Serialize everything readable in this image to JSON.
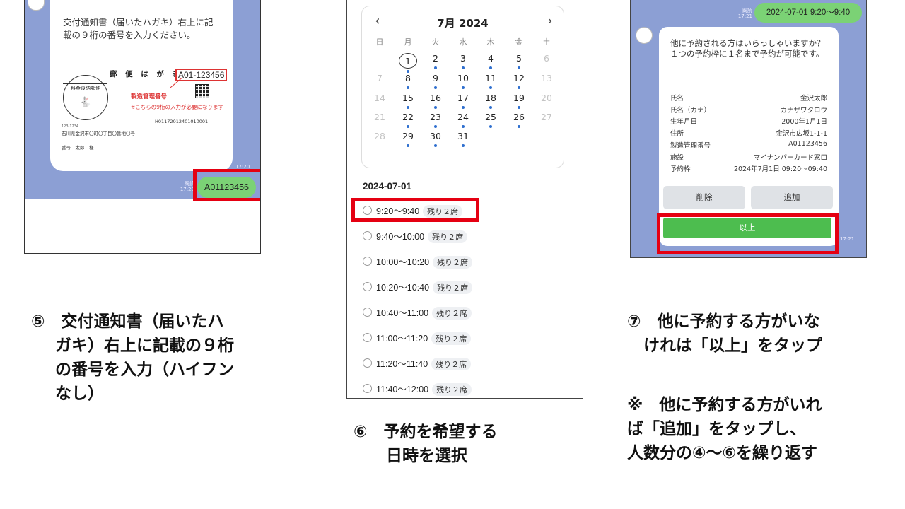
{
  "panel1": {
    "instruction": [
      "交付通知書（届いたハガキ）右上に記",
      "載の９桁の番号を入力ください。"
    ],
    "postcard": {
      "title": "郵 便 は が き",
      "number": "A01-123456",
      "stamp_label": "料金後納郵便",
      "label": "製造管理番号",
      "note": "※こちらの9桁の入力が必要になります",
      "id_line": "H01172012401010001",
      "zip": "123-1234",
      "address": "石川県金沢市〇町〇丁目〇番地〇号",
      "name": "番号　太郎　様"
    },
    "bubble_time": "17:20",
    "read_label": "既読",
    "reply_time": "17:20",
    "reply": "A01123456"
  },
  "caption5": [
    "⑤　交付通知書（届いたハ",
    "ガキ）右上に記載の９桁",
    "の番号を入力（ハイフン",
    "なし）"
  ],
  "panel2": {
    "month_label": "7月 2024",
    "prev_icon": "‹",
    "next_icon": "›",
    "weekdays": [
      "日",
      "月",
      "火",
      "水",
      "木",
      "金",
      "土"
    ],
    "weeks": [
      [
        "",
        "1",
        "2",
        "3",
        "4",
        "5",
        "6"
      ],
      [
        "7",
        "8",
        "9",
        "10",
        "11",
        "12",
        "13"
      ],
      [
        "14",
        "15",
        "16",
        "17",
        "18",
        "19",
        "20"
      ],
      [
        "21",
        "22",
        "23",
        "24",
        "25",
        "26",
        "27"
      ],
      [
        "28",
        "29",
        "30",
        "31",
        "",
        "",
        ""
      ]
    ],
    "selected_date": "2024-07-01",
    "slots": [
      {
        "time": "9:20〜9:40",
        "seats": "残り２席"
      },
      {
        "time": "9:40〜10:00",
        "seats": "残り２席"
      },
      {
        "time": "10:00〜10:20",
        "seats": "残り２席"
      },
      {
        "time": "10:20〜10:40",
        "seats": "残り２席"
      },
      {
        "time": "10:40〜11:00",
        "seats": "残り２席"
      },
      {
        "time": "11:00〜11:20",
        "seats": "残り２席"
      },
      {
        "time": "11:20〜11:40",
        "seats": "残り２席"
      },
      {
        "time": "11:40〜12:00",
        "seats": "残り２席"
      }
    ]
  },
  "caption6": [
    "⑥　予約を希望する",
    "　　日時を選択"
  ],
  "panel3": {
    "read_label": "既読",
    "read_time": "17:21",
    "message": "2024-07-01 9:20〜9:40",
    "question": "他に予約される方はいらっしゃいますか？１つの予約枠に１名まで予約が可能です。",
    "rows": [
      {
        "k": "氏名",
        "v": "金沢太郎"
      },
      {
        "k": "氏名（カナ）",
        "v": "カナザワタロウ"
      },
      {
        "k": "生年月日",
        "v": "2000年1月1日"
      },
      {
        "k": "住所",
        "v": "金沢市広坂1-1-1"
      },
      {
        "k": "製造管理番号",
        "v": "A01123456"
      },
      {
        "k": "施設",
        "v": "マイナンバーカード窓口"
      },
      {
        "k": "予約枠",
        "v": "2024年7月1日 09:20〜09:40"
      }
    ],
    "delete_label": "削除",
    "add_label": "追加",
    "ok_label": "以上",
    "card_time": "17:21"
  },
  "caption7": [
    "⑦　他に予約する方がいな",
    "　けれは「以上」をタップ"
  ],
  "caption_note": [
    "※　他に予約する方がいれ",
    "ば「追加」をタップし、",
    "人数分の④〜⑥を繰り返す"
  ],
  "colors": {
    "highlight": "#e50012",
    "line_bg": "#8c9fd4",
    "green": "#7bd275"
  }
}
